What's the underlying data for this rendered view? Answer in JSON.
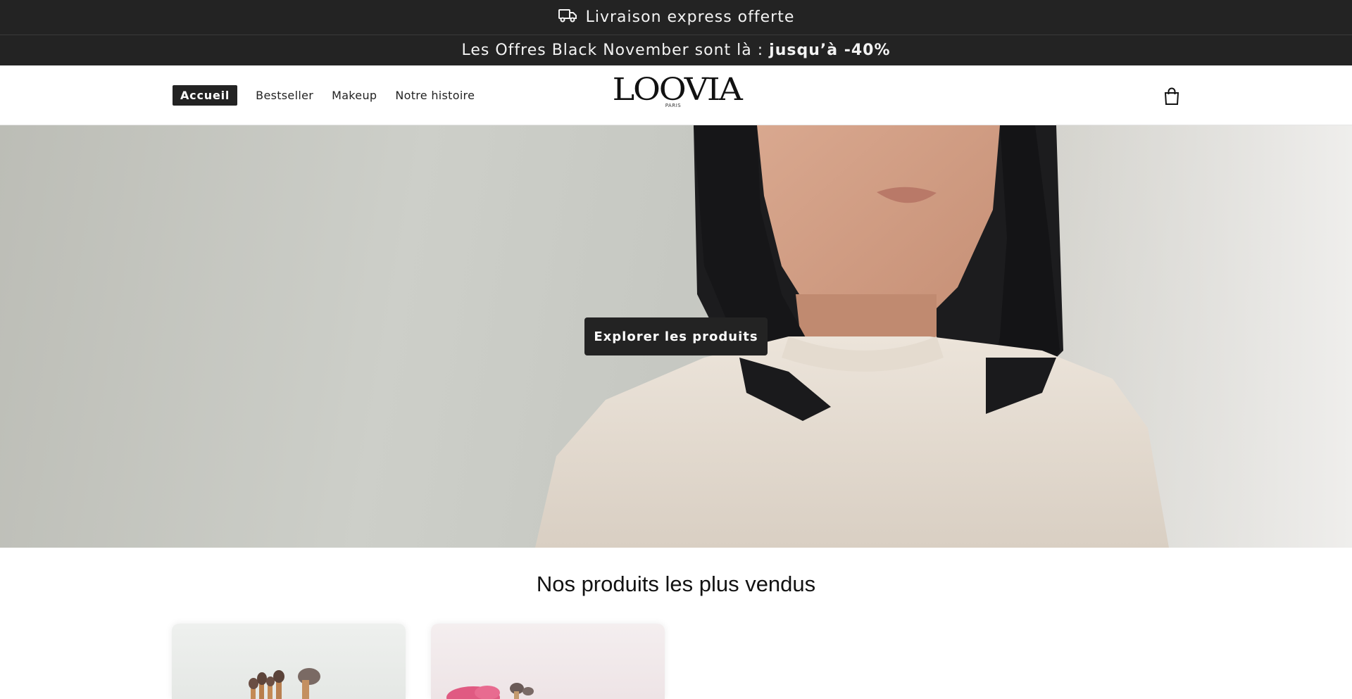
{
  "announcements": {
    "shipping_text": "Livraison express offerte",
    "shipping_icon": "truck-icon",
    "promo_text": "Les Offres Black November sont là :",
    "promo_highlight": "jusqu’à -40%"
  },
  "header": {
    "nav": [
      {
        "label": "Accueil",
        "active": true
      },
      {
        "label": "Bestseller",
        "active": false
      },
      {
        "label": "Makeup",
        "active": false
      },
      {
        "label": "Notre histoire",
        "active": false
      }
    ],
    "logo": {
      "name": "LOOVIA",
      "sub": "PARIS"
    },
    "cart_icon": "shopping-bag-icon"
  },
  "hero": {
    "cta_label": "Explorer les produits"
  },
  "bestsellers": {
    "title": "Nos produits les plus vendus"
  },
  "colors": {
    "bar_bg": "#232323",
    "text": "#121212",
    "white": "#ffffff"
  }
}
